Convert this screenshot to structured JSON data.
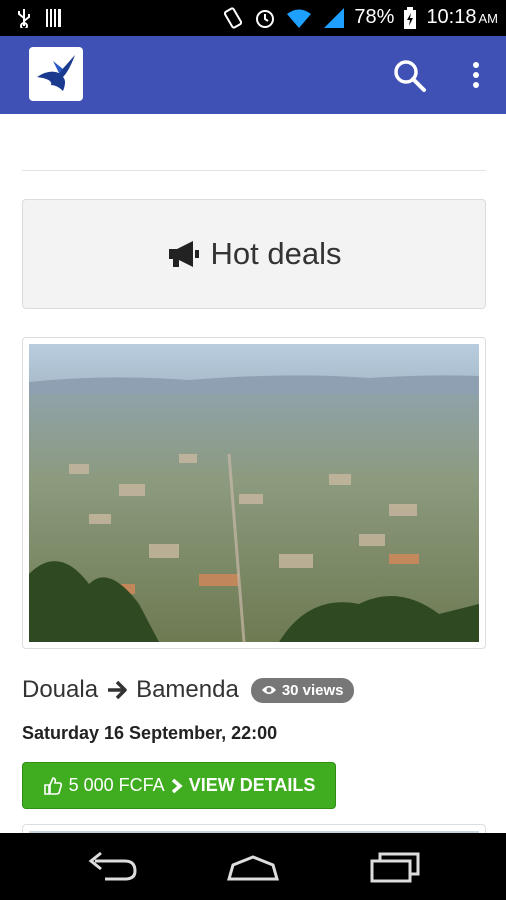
{
  "status_bar": {
    "battery": "78%",
    "time": "10:18",
    "ampm": "AM"
  },
  "app_bar": {
    "icons": [
      "bird-logo-icon",
      "search-icon",
      "overflow-menu-icon"
    ]
  },
  "hot_deals": {
    "title": "Hot deals",
    "icon": "megaphone-icon"
  },
  "deal": {
    "from": "Douala",
    "to": "Bamenda",
    "views": "30 views",
    "datetime": "Saturday 16 September, 22:00",
    "price": "5 000 FCFA",
    "cta_label": "VIEW DETAILS"
  },
  "colors": {
    "app_bar": "#3f51b5",
    "cta": "#3fad1f",
    "badge": "#777777"
  }
}
